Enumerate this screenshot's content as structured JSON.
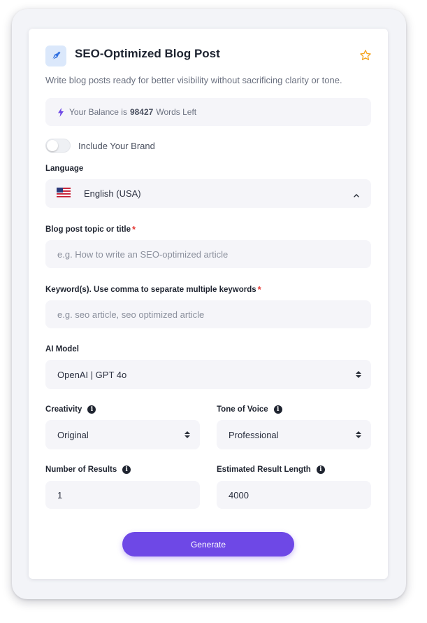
{
  "header": {
    "title": "SEO-Optimized Blog Post",
    "subtitle": "Write blog posts ready for better visibility without sacrificing clarity or tone.",
    "icon": "pen-nib-icon",
    "favorite_icon": "star-icon"
  },
  "balance": {
    "prefix": "Your Balance is",
    "amount": "98427",
    "suffix": "Words Left",
    "icon": "bolt-icon"
  },
  "brand_toggle": {
    "label": "Include Your Brand",
    "on": false
  },
  "language": {
    "label": "Language",
    "value": "English (USA)",
    "flag": "us-flag-icon"
  },
  "topic": {
    "label": "Blog post topic or title",
    "required_mark": "*",
    "placeholder": "e.g. How to write an SEO-optimized article"
  },
  "keywords": {
    "label": "Keyword(s). Use comma to separate multiple keywords",
    "required_mark": "*",
    "placeholder": "e.g. seo article, seo optimized article"
  },
  "ai_model": {
    "label": "AI Model",
    "value": "OpenAI | GPT 4o"
  },
  "creativity": {
    "label": "Creativity",
    "value": "Original"
  },
  "tone": {
    "label": "Tone of Voice",
    "value": "Professional"
  },
  "results": {
    "label": "Number of Results",
    "value": "1"
  },
  "length": {
    "label": "Estimated Result Length",
    "value": "4000"
  },
  "generate_label": "Generate",
  "colors": {
    "accent": "#6e48e6",
    "required": "#e53935",
    "field_bg": "#f5f5f9",
    "star": "#f5a623"
  }
}
